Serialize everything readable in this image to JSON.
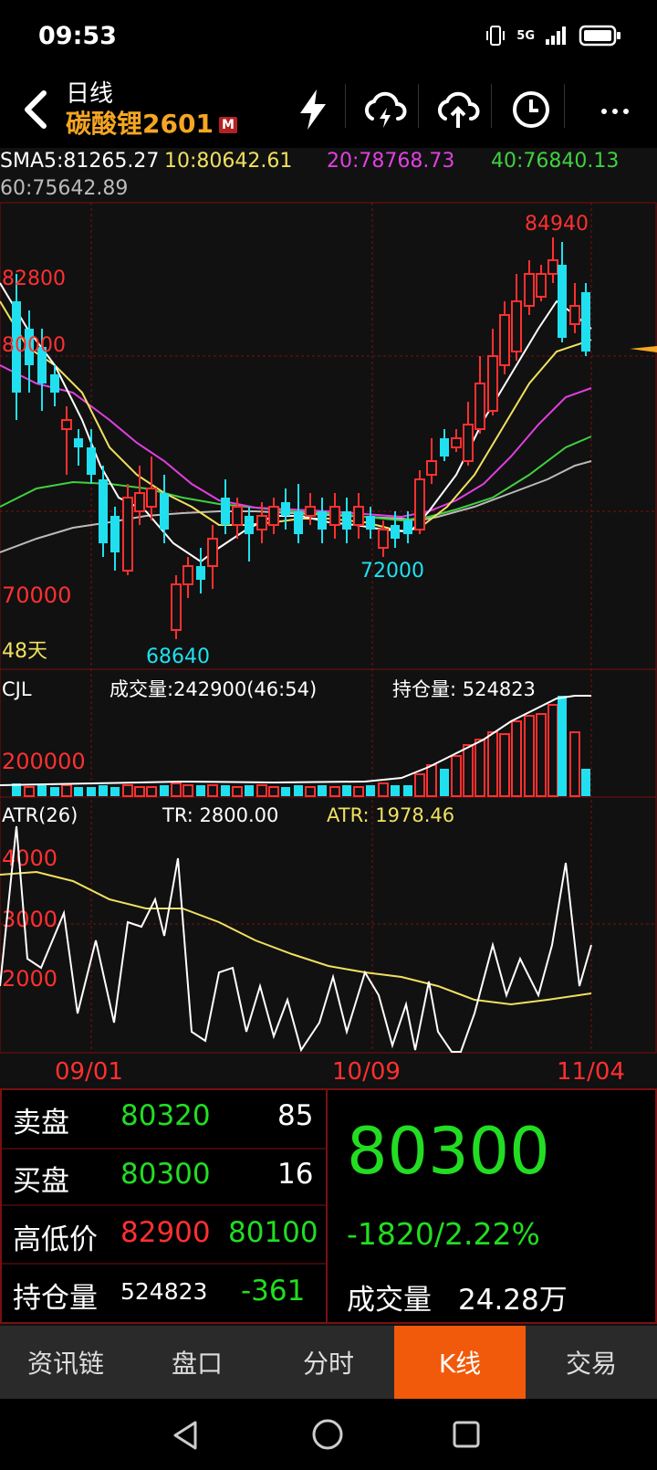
{
  "status": {
    "time": "09:53",
    "network": "5G"
  },
  "header": {
    "period": "日线",
    "symbol": "碳酸锂2601",
    "badge": "M"
  },
  "ma": {
    "sma5": "SMA5:81265.27",
    "ma10": "10:80642.61",
    "ma20": "20:78768.73",
    "ma40": "40:76840.13",
    "ma60": "60:75642.89",
    "colors": {
      "sma5": "#ffffff",
      "ma10": "#f0e060",
      "ma20": "#e040e0",
      "ma40": "#40d040",
      "ma60": "#bbbbbb"
    }
  },
  "main_chart": {
    "label_high": "84940",
    "label_82800": "82800",
    "label_80000": "80000",
    "label_72000": "72000",
    "label_70000": "70000",
    "label_low": "68640",
    "days": "48天"
  },
  "volume_panel": {
    "name": "CJL",
    "volume": "成交量:242900(46:54)",
    "open_interest": "持仓量: 524823",
    "scale": "200000"
  },
  "atr_panel": {
    "name": "ATR(26)",
    "tr": "TR: 2800.00",
    "atr": "ATR: 1978.46",
    "y4000": "4000",
    "y3000": "3000",
    "y2000": "2000"
  },
  "dates": {
    "d1": "09/01",
    "d2": "10/09",
    "d3": "11/04"
  },
  "quote": {
    "ask_label": "卖盘",
    "ask_price": "80320",
    "ask_vol": "85",
    "bid_label": "买盘",
    "bid_price": "80300",
    "bid_vol": "16",
    "hl_label": "高低价",
    "high": "82900",
    "low": "80100",
    "oi_label": "持仓量",
    "oi": "524823",
    "oi_change": "-361",
    "last_price": "80300",
    "change": "-1820/2.22%",
    "vol_label": "成交量",
    "vol_value": "24.28万"
  },
  "tabs": [
    {
      "label": "资讯链",
      "active": false
    },
    {
      "label": "盘口",
      "active": false
    },
    {
      "label": "分时",
      "active": false
    },
    {
      "label": "K线",
      "active": true
    },
    {
      "label": "交易",
      "active": false
    }
  ],
  "colors": {
    "up": "#ff3030",
    "down": "#20e0f0",
    "green": "#22dd22",
    "accent": "#f05a0a",
    "gold": "#f5a623"
  },
  "icons": [
    "back-icon",
    "lightning-icon",
    "cloud-download-icon",
    "cloud-upload-icon",
    "clock-icon",
    "more-icon",
    "triangle-back-icon",
    "circle-home-icon",
    "square-recent-icon"
  ]
}
